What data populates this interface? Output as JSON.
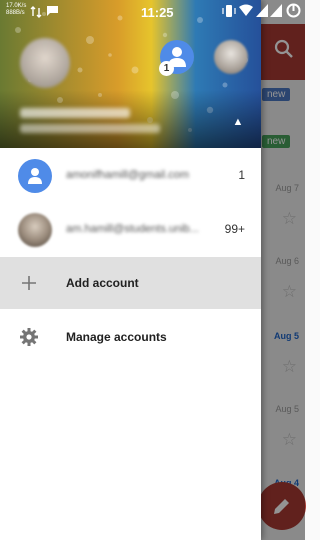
{
  "status_bar": {
    "network_speed": "17.0K/s 888B/s",
    "time": "11:25"
  },
  "drawer": {
    "header": {
      "current_account_badge": "1"
    },
    "accounts": [
      {
        "email": "amonifhamill@gmail.com",
        "unread_count": "1",
        "avatar": "person-icon"
      },
      {
        "email": "am.hamill@students.unib...",
        "unread_count": "99+",
        "avatar": "photo"
      }
    ],
    "menu": {
      "add_account": "Add account",
      "manage_accounts": "Manage accounts"
    }
  },
  "background_list": {
    "chips": [
      "new",
      "new"
    ],
    "dates": [
      "Aug 7",
      "Aug 6",
      "Aug 5",
      "Aug 5",
      "Aug 4"
    ]
  },
  "colors": {
    "toolbar": "#a83a32",
    "avatar_blue": "#4f8be8",
    "highlight_row": "#e0e0e0"
  }
}
